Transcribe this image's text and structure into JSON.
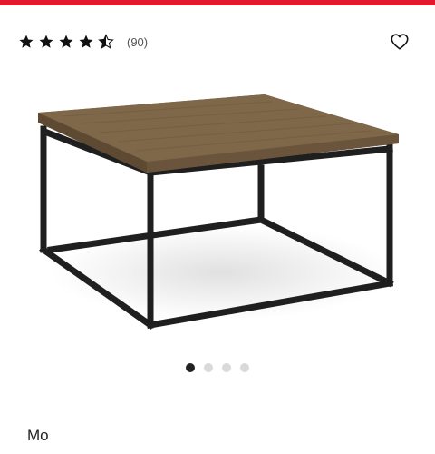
{
  "rating": {
    "value": 4.5,
    "max": 5,
    "count_label": "(90)"
  },
  "icons": {
    "favorite": "heart-outline-icon",
    "star_full": "star-filled-icon",
    "star_half": "star-half-icon"
  },
  "gallery": {
    "total": 4,
    "active_index": 0
  },
  "description": {
    "text": "Mo"
  },
  "colors": {
    "accent": "#e3182d",
    "wood": "#7a6347",
    "frame": "#1f1f1f",
    "dot_active": "#222222",
    "dot_inactive": "#d9d9d9"
  }
}
